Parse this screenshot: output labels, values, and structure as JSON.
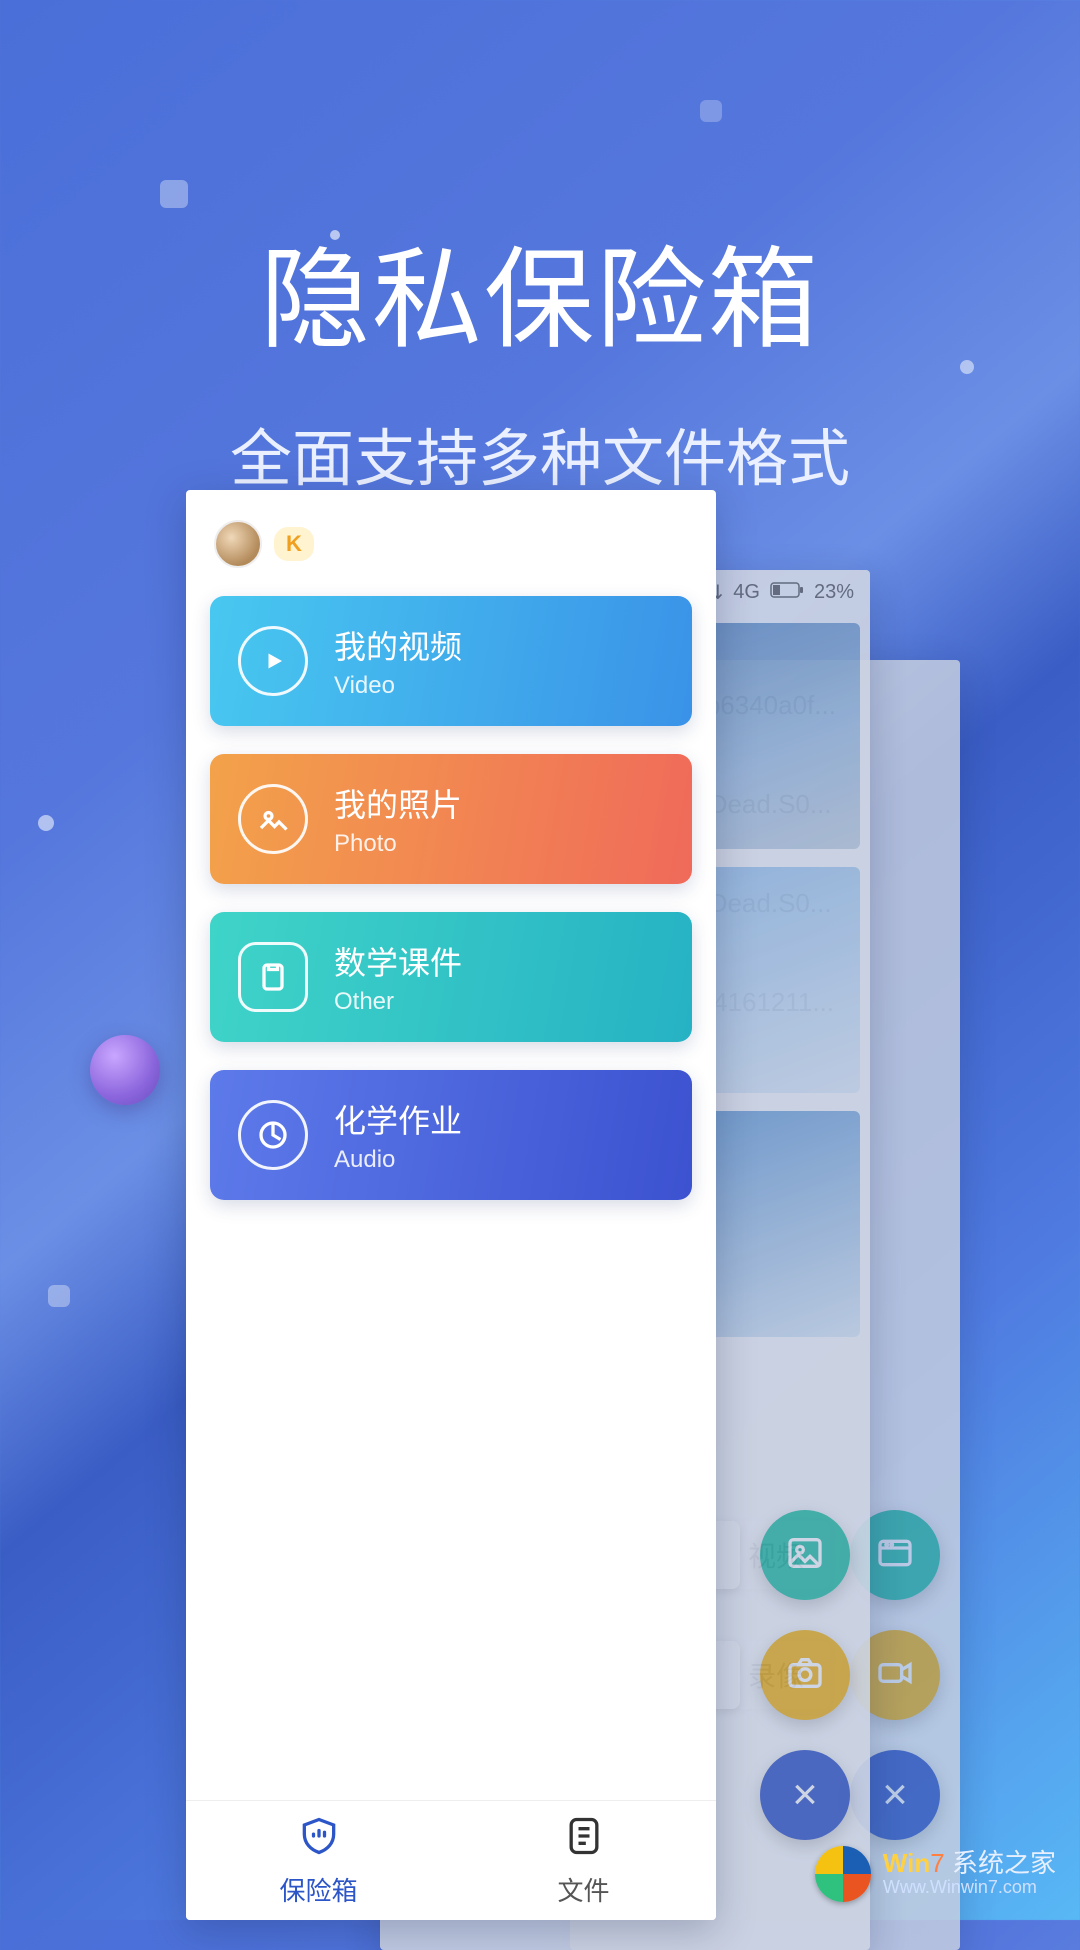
{
  "hero": {
    "title": "隐私保险箱",
    "subtitle": "全面支持多种文件格式"
  },
  "status": {
    "network": "4G",
    "battery": "23%"
  },
  "categories": [
    {
      "title": "我的视频",
      "sub": "Video",
      "kind": "video"
    },
    {
      "title": "我的照片",
      "sub": "Photo",
      "kind": "photo"
    },
    {
      "title": "数学课件",
      "sub": "Other",
      "kind": "other"
    },
    {
      "title": "化学作业",
      "sub": "Audio",
      "kind": "audio"
    }
  ],
  "tabs": {
    "vault": "保险箱",
    "files": "文件"
  },
  "fab_mid": {
    "gallery": "相册",
    "camera": "拍照",
    "close": "×"
  },
  "fab_back": {
    "video": "视频",
    "record": "录像",
    "close": "×"
  },
  "back_files": [
    "3906b6340a0f...",
    "lking.Dead.S0...",
    "lking.Dead.S0...",
    "e93f74161211..."
  ],
  "badge": "K",
  "watermark": {
    "brand_a": "Win",
    "brand_b": "7",
    "name": "系统之家",
    "url": "Www.Winwin7.com"
  }
}
